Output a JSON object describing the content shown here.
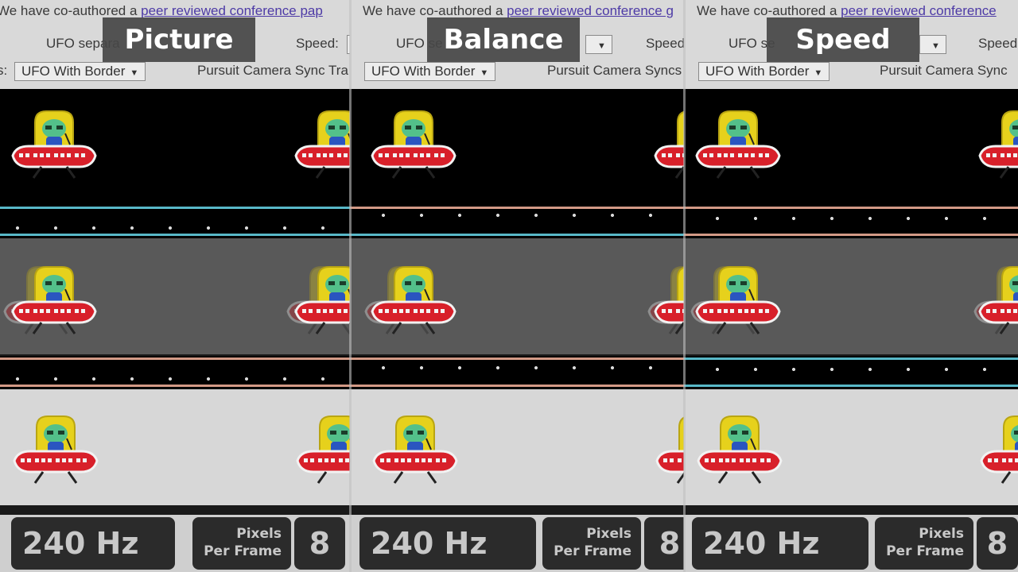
{
  "panels": [
    {
      "title": "Picture",
      "notice": {
        "prefix": "We have co-authored a ",
        "link": "peer reviewed conference pap"
      },
      "separation_label": "UFO separa",
      "speed_label": "Speed:",
      "ufo_select": "UFO With Border",
      "pursuit_label": "Pursuit Camera Sync Tra",
      "refresh": "240 Hz",
      "ppf_line1": "Pixels",
      "ppf_line2": "Per Frame",
      "ppf_value": "8"
    },
    {
      "title": "Balance",
      "notice": {
        "prefix": "We have co-authored a ",
        "link": "peer reviewed conference g"
      },
      "separation_label": "UFO se",
      "speed_label": "Speed",
      "ufo_select": "UFO With Border",
      "pursuit_label": "Pursuit Camera Syncs",
      "refresh": "240 Hz",
      "ppf_line1": "Pixels",
      "ppf_line2": "Per Frame",
      "ppf_value": "8"
    },
    {
      "title": "Speed",
      "notice": {
        "prefix": "We have co-authored a ",
        "link": "peer reviewed conference"
      },
      "separation_label": "UFO se",
      "speed_label": "Speed",
      "ufo_select": "UFO With Border",
      "pursuit_label": "Pursuit Camera Sync",
      "refresh": "240 Hz",
      "ppf_line1": "Pixels",
      "ppf_line2": "Per Frame",
      "ppf_value": "8"
    }
  ],
  "colors": {
    "track_top": "#000000",
    "track_middle": "#595959",
    "track_bottom": "#d7d7d7",
    "line_cyan": "#58b8c8",
    "line_salmon": "#d39a86",
    "ufo_saucer": "#d8202a",
    "ufo_canopy": "#e6d11c",
    "alien": "#53c08a",
    "alien_body": "#2a55c0"
  },
  "icons": [
    "ufo-icon",
    "dropdown-arrow-icon"
  ]
}
